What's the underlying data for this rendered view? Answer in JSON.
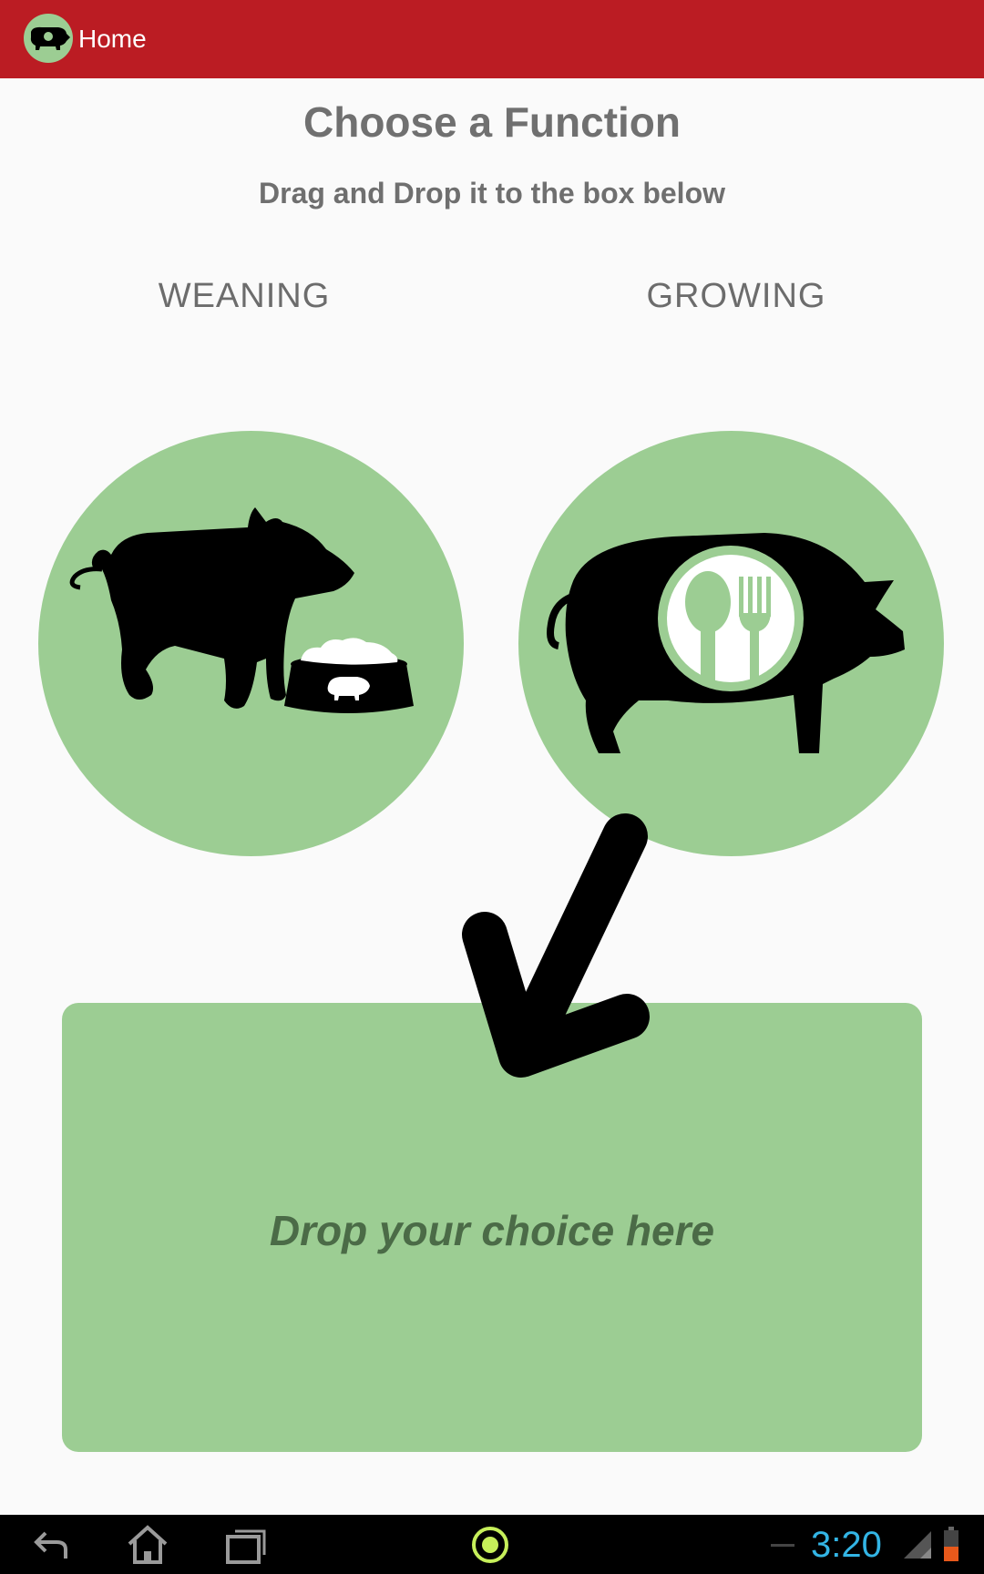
{
  "action_bar": {
    "title": "Home",
    "background": "#bb1c23",
    "app_icon": "pig-logo-icon"
  },
  "main": {
    "title": "Choose a Function",
    "subtitle": "Drag and Drop it to the box below",
    "options": [
      {
        "label": "WEANING",
        "icon": "weaning-pig-icon"
      },
      {
        "label": "GROWING",
        "icon": "growing-pig-icon"
      }
    ],
    "drop_zone": {
      "text": "Drop your choice here"
    },
    "arrow_icon": "arrow-down-left-icon",
    "accent_color": "#9ccd93"
  },
  "system_bar": {
    "time": "3:20",
    "clock_color": "#33b5e5",
    "icons": [
      "back-icon",
      "home-icon",
      "recent-apps-icon",
      "assistant-icon",
      "signal-icon",
      "battery-icon"
    ]
  }
}
